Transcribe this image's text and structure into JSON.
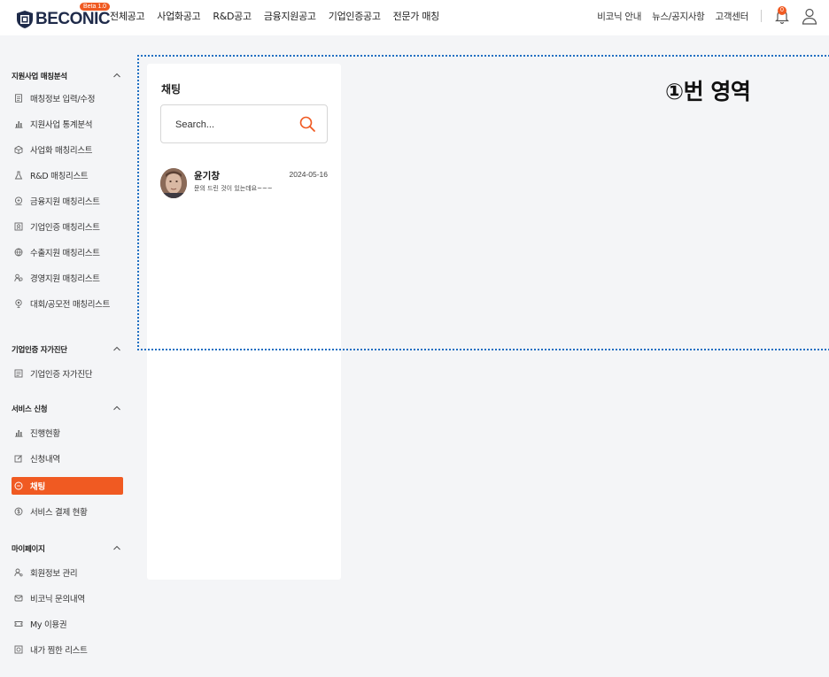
{
  "header": {
    "logo_text": "BECONIC",
    "beta_badge": "Beta 1.0",
    "nav": [
      "전체공고",
      "사업화공고",
      "R&D공고",
      "금융지원공고",
      "기업인증공고",
      "전문가 매칭"
    ],
    "util": [
      "비코닉 안내",
      "뉴스/공지사항",
      "고객센터"
    ],
    "notification_count": "0"
  },
  "sidebar": {
    "sections": [
      {
        "title": "지원사업 매칭분석",
        "items": [
          {
            "label": "매칭정보 입력/수정",
            "icon": "document-icon"
          },
          {
            "label": "지원사업 통계분석",
            "icon": "bar-chart-icon"
          },
          {
            "label": "사업화 매칭리스트",
            "icon": "box-icon"
          },
          {
            "label": "R&D 매칭리스트",
            "icon": "flask-icon"
          },
          {
            "label": "금융지원 매칭리스트",
            "icon": "coin-icon"
          },
          {
            "label": "기업인증 매칭리스트",
            "icon": "certificate-icon"
          },
          {
            "label": "수출지원 매칭리스트",
            "icon": "globe-icon"
          },
          {
            "label": "경영지원 매칭리스트",
            "icon": "people-icon"
          },
          {
            "label": "대회/공모전 매칭리스트",
            "icon": "trophy-icon"
          }
        ]
      },
      {
        "title": "기업인증 자가진단",
        "items": [
          {
            "label": "기업인증 자가진단",
            "icon": "checklist-icon"
          }
        ]
      },
      {
        "title": "서비스 신청",
        "items": [
          {
            "label": "진행현황",
            "icon": "bar-chart-icon"
          },
          {
            "label": "신청내역",
            "icon": "edit-icon"
          },
          {
            "label": "채팅",
            "icon": "chat-icon",
            "active": true
          },
          {
            "label": "서비스 결제 현황",
            "icon": "dollar-circle-icon"
          }
        ]
      },
      {
        "title": "마이페이지",
        "items": [
          {
            "label": "회원정보 관리",
            "icon": "user-settings-icon"
          },
          {
            "label": "비코닉 문의내역",
            "icon": "mail-icon"
          },
          {
            "label": "My 이용권",
            "icon": "ticket-icon"
          },
          {
            "label": "내가 찜한 리스트",
            "icon": "bookmark-icon"
          }
        ]
      }
    ]
  },
  "chat": {
    "title": "채팅",
    "search_placeholder": "Search...",
    "conversations": [
      {
        "name": "윤기창",
        "date": "2024-05-16",
        "preview": "문의 드린 것이 있는데요~~~"
      }
    ]
  },
  "annotation": {
    "label": "①번 영역",
    "color": "#1f6fc2"
  },
  "colors": {
    "accent": "#f05a22",
    "brand_navy": "#1f2b4a"
  }
}
